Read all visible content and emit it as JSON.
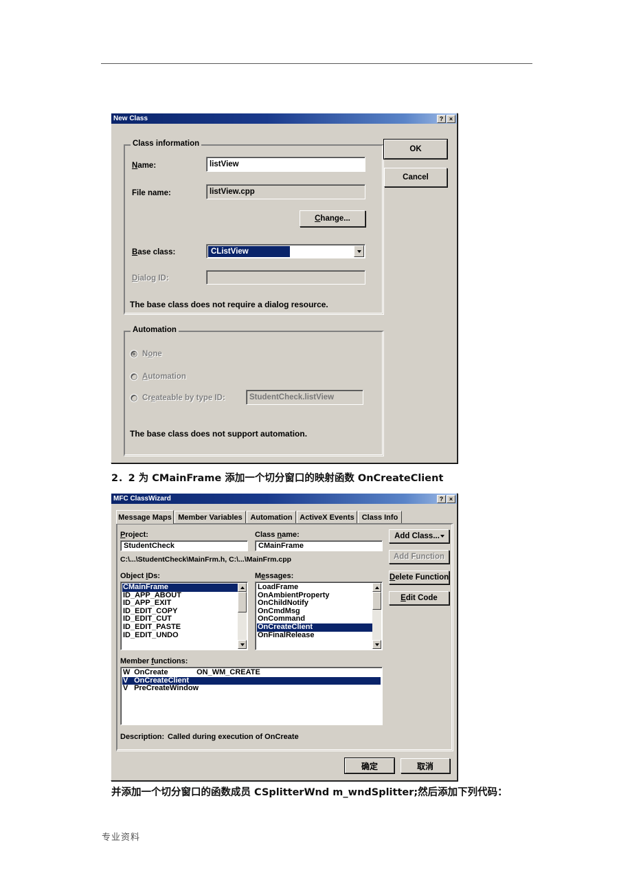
{
  "document": {
    "line1": "2．2 为 CMainFrame 添加一个切分窗口的映射函数 OnCreateClient",
    "line2": "并添加一个切分窗口的函数成员 CSplitterWnd m_wndSplitter;然后添加下列代码：",
    "footer": "专业资料"
  },
  "new_class_dialog": {
    "title": "New Class",
    "titlebar_buttons": {
      "help": "?",
      "close": "×"
    },
    "class_information": {
      "group_label": "Class information",
      "name_label": "Name:",
      "name_value": "listView",
      "file_name_label": "File name:",
      "file_name_value": "listView.cpp",
      "change_button": "Change...",
      "base_class_label": "Base class:",
      "base_class_value": "CListView",
      "dialog_id_label": "Dialog ID:",
      "dialog_id_value": "",
      "note": "The base class does not require a dialog resource."
    },
    "automation": {
      "group_label": "Automation",
      "options": [
        {
          "label": "None",
          "selected": true
        },
        {
          "label": "Automation",
          "selected": false
        },
        {
          "label": "Createable by type ID:",
          "selected": false
        }
      ],
      "type_id_value": "StudentCheck.listView",
      "note": "The base class does not support automation."
    },
    "ok_button": "OK",
    "cancel_button": "Cancel"
  },
  "class_wizard_dialog": {
    "title": "MFC ClassWizard",
    "titlebar_buttons": {
      "help": "?",
      "close": "×"
    },
    "tabs": [
      {
        "label": "Message Maps",
        "active": true
      },
      {
        "label": "Member Variables",
        "active": false
      },
      {
        "label": "Automation",
        "active": false
      },
      {
        "label": "ActiveX Events",
        "active": false
      },
      {
        "label": "Class Info",
        "active": false
      }
    ],
    "project_label": "Project:",
    "project_value": "StudentCheck",
    "class_name_label": "Class name:",
    "class_name_value": "CMainFrame",
    "file_paths": "C:\\...\\StudentCheck\\MainFrm.h, C:\\...\\MainFrm.cpp",
    "object_ids_label": "Object IDs:",
    "object_ids": [
      {
        "text": "CMainFrame",
        "selected": true
      },
      {
        "text": "ID_APP_ABOUT",
        "selected": false
      },
      {
        "text": "ID_APP_EXIT",
        "selected": false
      },
      {
        "text": "ID_EDIT_COPY",
        "selected": false
      },
      {
        "text": "ID_EDIT_CUT",
        "selected": false
      },
      {
        "text": "ID_EDIT_PASTE",
        "selected": false
      },
      {
        "text": "ID_EDIT_UNDO",
        "selected": false
      }
    ],
    "messages_label": "Messages:",
    "messages": [
      {
        "text": "LoadFrame",
        "selected": false
      },
      {
        "text": "OnAmbientProperty",
        "selected": false
      },
      {
        "text": "OnChildNotify",
        "selected": false
      },
      {
        "text": "OnCmdMsg",
        "selected": false
      },
      {
        "text": "OnCommand",
        "selected": false
      },
      {
        "text": "OnCreateClient",
        "selected": true
      },
      {
        "text": "OnFinalRelease",
        "selected": false
      }
    ],
    "member_functions_label": "Member functions:",
    "member_functions": [
      {
        "kind": "W",
        "name": "OnCreate",
        "message": "ON_WM_CREATE",
        "selected": false
      },
      {
        "kind": "V",
        "name": "OnCreateClient",
        "message": "",
        "selected": true
      },
      {
        "kind": "V",
        "name": "PreCreateWindow",
        "message": "",
        "selected": false
      }
    ],
    "buttons": {
      "add_class": "Add Class...",
      "add_function": "Add Function",
      "delete_function": "Delete Function",
      "edit_code": "Edit Code"
    },
    "description_label": "Description:",
    "description_value": "Called during execution of OnCreate",
    "ok_button": "确定",
    "cancel_button": "取消"
  }
}
